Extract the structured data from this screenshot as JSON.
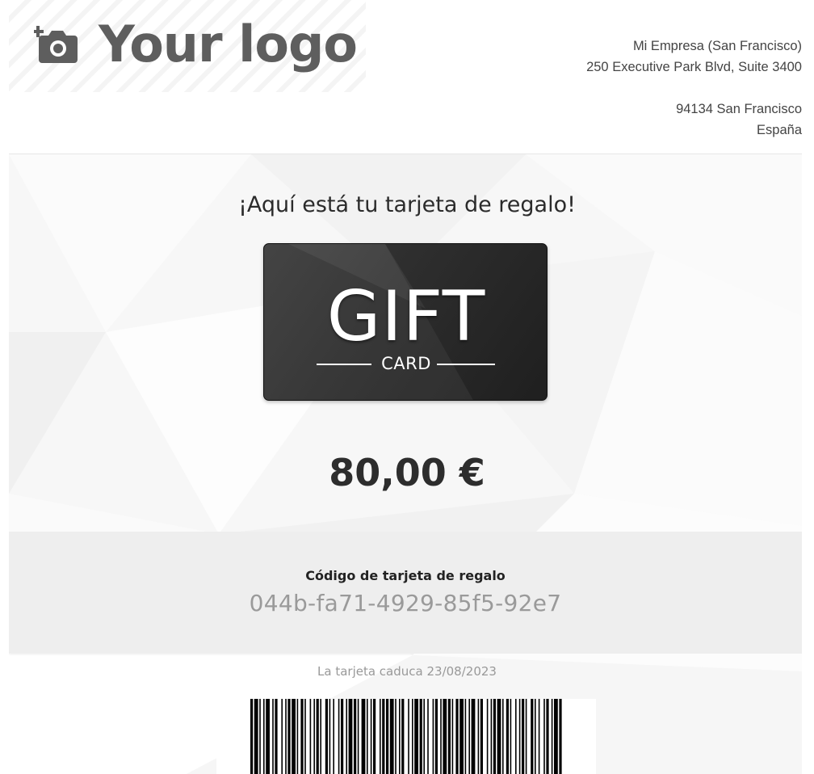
{
  "header": {
    "logo_text": "Your logo",
    "logo_icon": "camera-add-icon",
    "address": {
      "company": "Mi Empresa (San Francisco)",
      "street": "250 Executive Park Blvd, Suite 3400",
      "city": "94134 San Francisco",
      "country": "España"
    }
  },
  "main": {
    "greeting": "¡Aquí está tu tarjeta de regalo!",
    "card": {
      "title": "GIFT",
      "subtitle": "CARD"
    },
    "amount": "80,00 €",
    "code": {
      "label": "Código de tarjeta de regalo",
      "value": "044b-fa71-4929-85f5-92e7"
    },
    "expiry": {
      "text": "La tarjeta caduca",
      "date": "23/08/2023"
    },
    "barcode_icon": "barcode-icon"
  },
  "colors": {
    "text_dark": "#333333",
    "logo_gray": "#5e5e5e",
    "code_gray": "#9a9a9a",
    "band_bg": "#eeeeee",
    "card_bg": "#2e2e2e"
  }
}
